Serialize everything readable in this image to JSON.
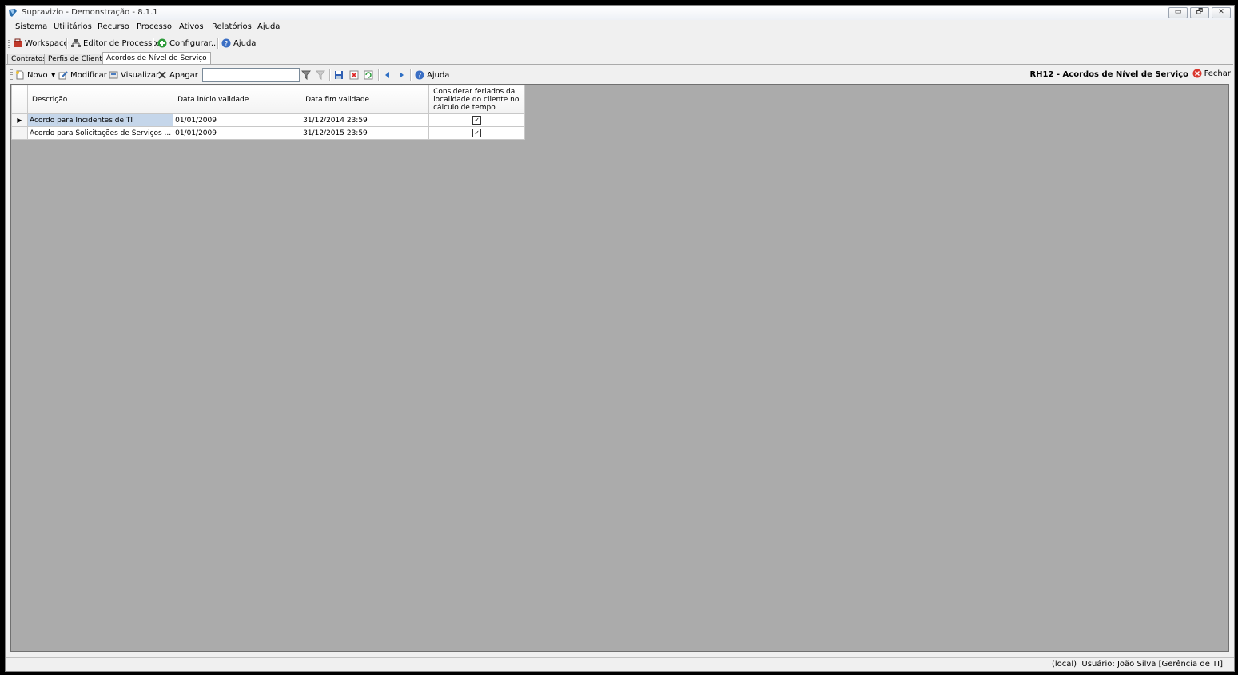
{
  "window": {
    "title": "Supravizio - Demonstração - 8.1.1",
    "buttons": {
      "minimize": "▭",
      "restore": "🗗",
      "close": "✕"
    }
  },
  "menu": [
    "Sistema",
    "Utilitários",
    "Recurso",
    "Processo",
    "Ativos",
    "Relatórios",
    "Ajuda"
  ],
  "toolbar1": {
    "workspace": "Workspace",
    "editor": "Editor de Processos",
    "configurar": "Configurar...",
    "ajuda": "Ajuda"
  },
  "tabs": [
    "Contratos",
    "Perfis de Clientes",
    "Acordos de Nível de Serviço"
  ],
  "toolbar2": {
    "novo": "Novo",
    "modificar": "Modificar",
    "visualizar": "Visualizar",
    "apagar": "Apagar",
    "search_value": "",
    "ajuda": "Ajuda",
    "screen_title": "RH12 - Acordos de Nível de Serviço",
    "fechar": "Fechar"
  },
  "grid": {
    "columns": [
      "Descrição",
      "Data início validade",
      "Data fim validade",
      "Considerar feriados da localidade do cliente no cálculo de tempo"
    ],
    "rows": [
      {
        "descricao": "Acordo para Incidentes de TI",
        "inicio": "01/01/2009",
        "fim": "31/12/2014 23:59",
        "feriados": true
      },
      {
        "descricao": "Acordo para Solicitações de Serviços ...",
        "inicio": "01/01/2009",
        "fim": "31/12/2015 23:59",
        "feriados": true
      }
    ]
  },
  "status": {
    "server": "(local)",
    "user": "Usuário: João Silva [Gerência de TI]"
  },
  "colors": {
    "grid_background": "#ababab",
    "selected_cell": "#c5d6ea",
    "close_icon": "#d9372e"
  }
}
